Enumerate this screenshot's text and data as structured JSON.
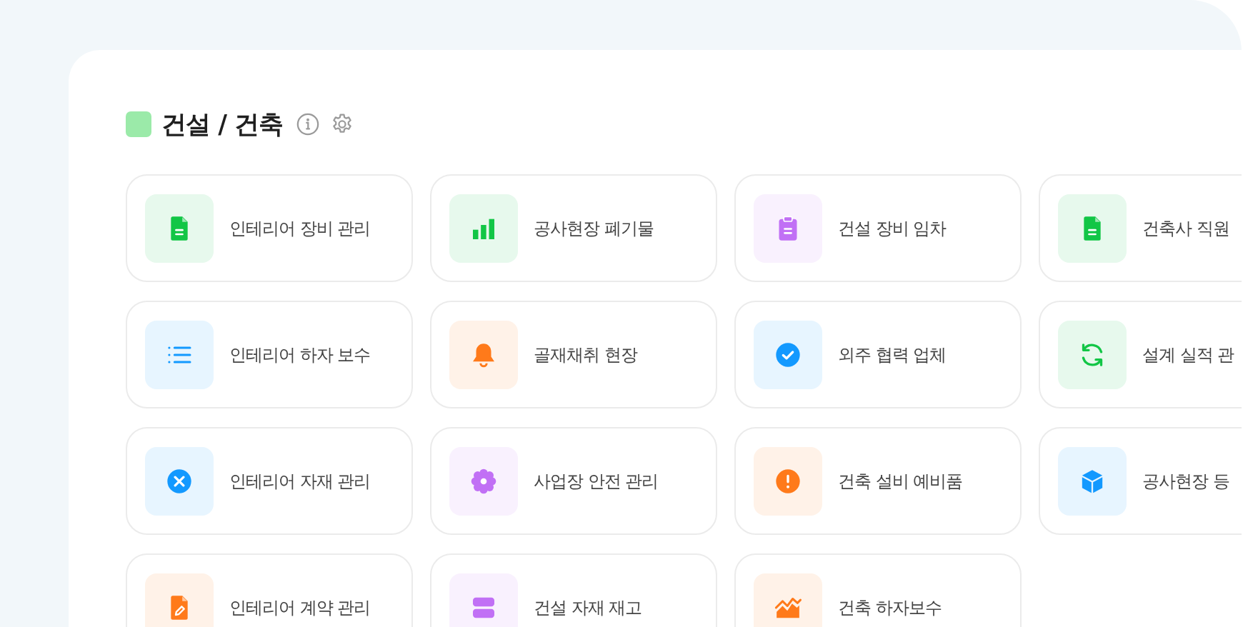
{
  "header": {
    "color": "#9beaa9",
    "title": "건설 / 건축"
  },
  "items": [
    {
      "label": "인테리어 장비 관리",
      "kind": "file",
      "color": "#12c646"
    },
    {
      "label": "공사현장 폐기물",
      "kind": "bars",
      "color": "#12c646"
    },
    {
      "label": "건설 장비 임차",
      "kind": "clipboard",
      "color": "#c170f5"
    },
    {
      "label": "건축사 직원",
      "kind": "file",
      "color": "#12c646"
    },
    {
      "label": "인테리어 하자 보수",
      "kind": "list",
      "color": "#1399ff"
    },
    {
      "label": "골재채취 현장",
      "kind": "bell",
      "color": "#ff7a1a"
    },
    {
      "label": "외주 협력 업체",
      "kind": "check",
      "color": "#1399ff"
    },
    {
      "label": "설계 실적 관",
      "kind": "refresh",
      "color": "#12c646"
    },
    {
      "label": "인테리어 자재 관리",
      "kind": "cross",
      "color": "#1399ff"
    },
    {
      "label": "사업장 안전 관리",
      "kind": "flower",
      "color": "#c170f5"
    },
    {
      "label": "건축 설비 예비품",
      "kind": "alert",
      "color": "#ff7a1a"
    },
    {
      "label": "공사현장 등",
      "kind": "cube",
      "color": "#1399ff"
    },
    {
      "label": "인테리어 계약 관리",
      "kind": "fileedit",
      "color": "#ff7a1a"
    },
    {
      "label": "건설 자재 재고",
      "kind": "stack",
      "color": "#c170f5"
    },
    {
      "label": "건축 하자보수",
      "kind": "area",
      "color": "#ff7a1a"
    }
  ]
}
